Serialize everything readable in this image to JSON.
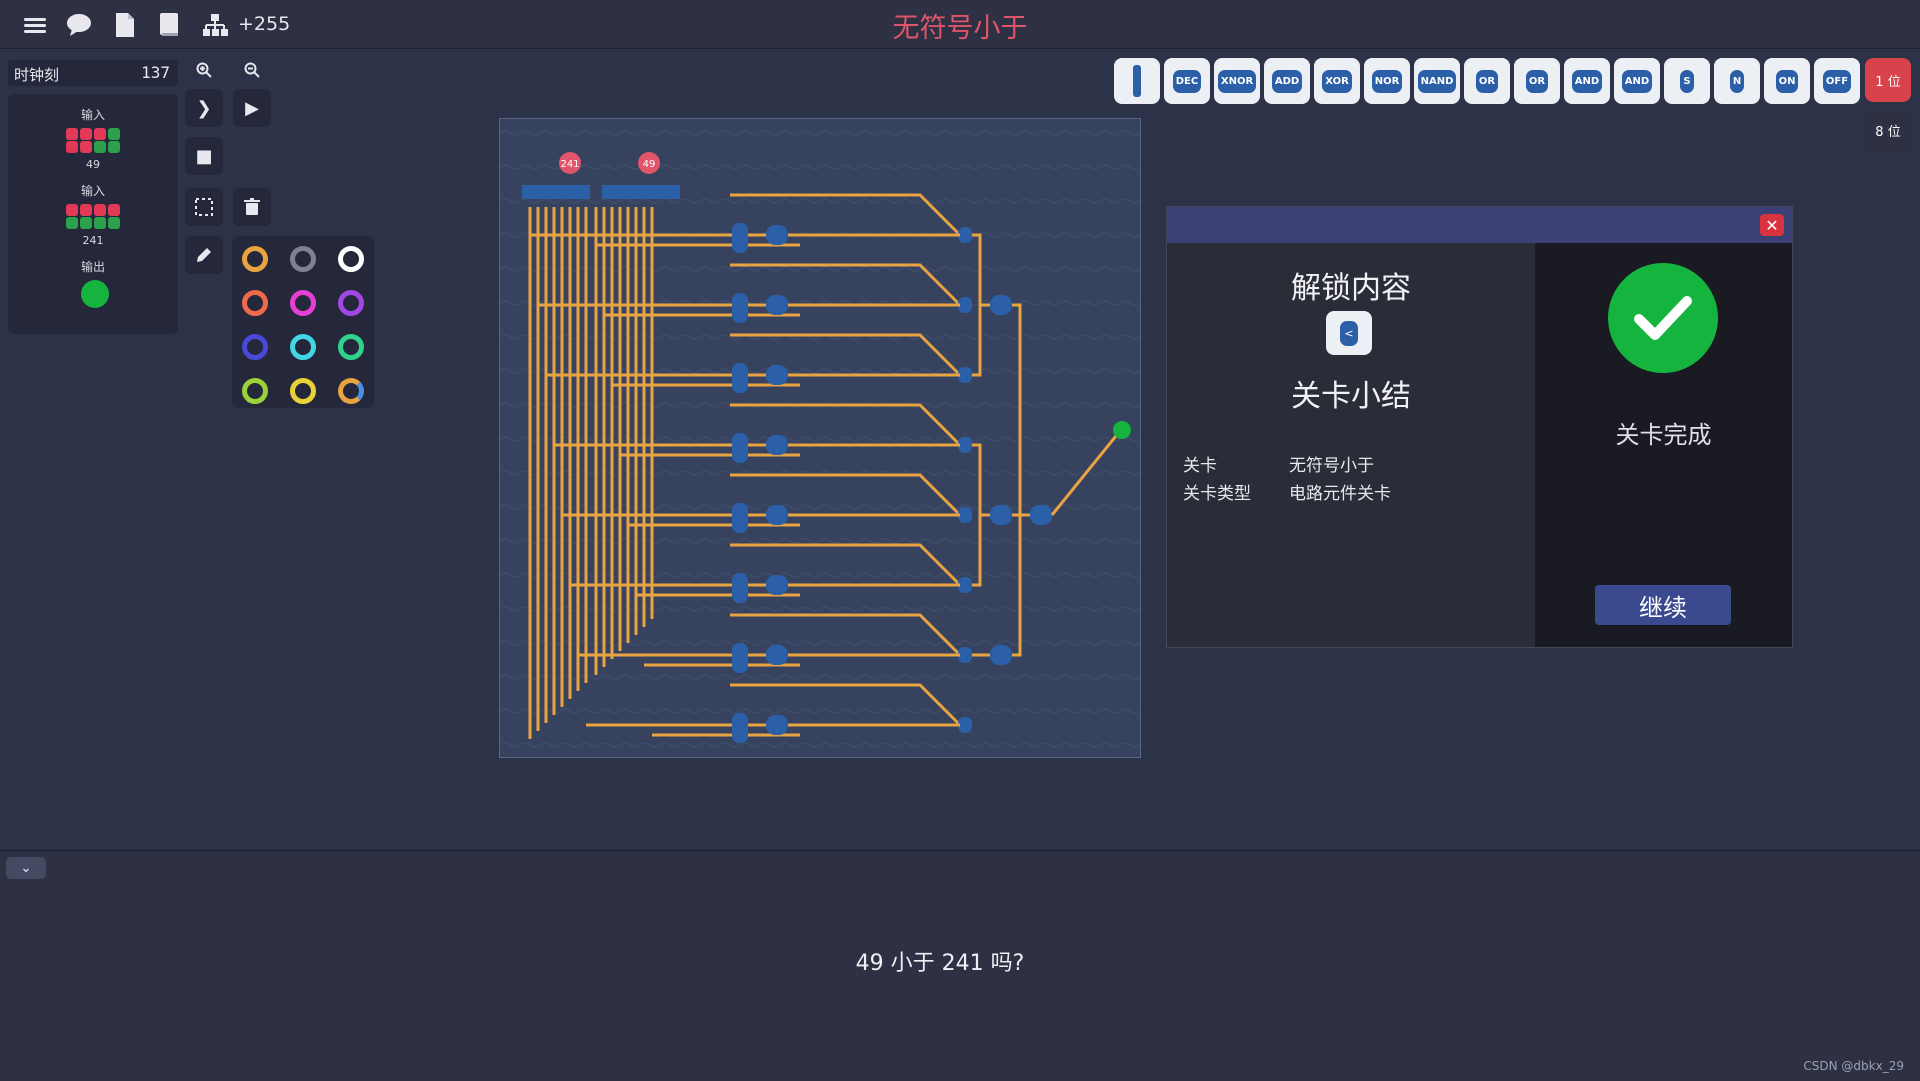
{
  "topbar": {
    "counter": "+255",
    "level_title": "无符号小于",
    "icons": [
      "menu-icon",
      "chat-icon",
      "document-icon",
      "book-icon",
      "hierarchy-icon"
    ]
  },
  "clock": {
    "label": "时钟刻",
    "value": "137"
  },
  "io": {
    "input1": {
      "label": "输入",
      "value": "49",
      "bits": [
        1,
        1,
        1,
        0,
        1,
        1,
        0,
        0
      ]
    },
    "input2": {
      "label": "输入",
      "value": "241",
      "bits": [
        1,
        1,
        1,
        1,
        0,
        0,
        0,
        0
      ]
    },
    "output": {
      "label": "输出",
      "state": "green"
    }
  },
  "board": {
    "pin_a": "241",
    "pin_b": "49"
  },
  "components": [
    "DEC",
    "XNOR",
    "ADD",
    "XOR",
    "NOR",
    "NAND",
    "OR",
    "OR",
    "AND",
    "AND",
    "S",
    "N",
    "ON",
    "OFF"
  ],
  "bit_buttons": {
    "one": "1 位",
    "eight": "8 位"
  },
  "colors": {
    "accent_red": "#e0556a",
    "wire": "#e9a441",
    "gate": "#2b5fa8",
    "success": "#14b43f"
  },
  "dialog": {
    "unlock_title": "解锁内容",
    "summary_title": "关卡小结",
    "level_key": "关卡",
    "level_value": "无符号小于",
    "type_key": "关卡类型",
    "type_value": "电路元件关卡",
    "complete_text": "关卡完成",
    "continue_label": "继续"
  },
  "bottom": {
    "question": "49 小于 241 吗?",
    "watermark": "CSDN @dbkx_29"
  }
}
